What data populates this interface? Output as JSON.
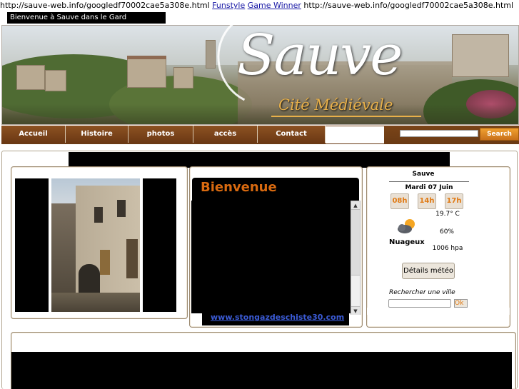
{
  "top": {
    "url_prefix": "http://sauve-web.info/googledf70002cae5a308e.html",
    "link1": "Funstyle",
    "link2": "Game Winner",
    "url_suffix": "http://sauve-web.info/googledf70002cae5a308e.html",
    "welcome": "Bienvenue à Sauve dans le Gard"
  },
  "banner": {
    "title": "Sauve",
    "subtitle": "Cité Médiévale"
  },
  "nav": {
    "items": [
      "Accueil",
      "Histoire",
      "photos",
      "accès",
      "Contact"
    ],
    "search_button": "Search"
  },
  "content": {
    "heading": "Bienvenue",
    "link": "www.stongazdeschiste30.com",
    "scroll_up": "▲",
    "scroll_down": "▼"
  },
  "weather": {
    "city": "Sauve",
    "date": "Mardi 07 Juin",
    "hours": [
      "08h",
      "14h",
      "17h"
    ],
    "temperature": "19.7° C",
    "icon": "cloudy-sun-icon",
    "humidity": "60%",
    "condition": "Nuageux",
    "pressure": "1006 hpa",
    "details_button": "Détails météo",
    "search_label": "Rechercher une ville",
    "ok_button": "Ok"
  },
  "colors": {
    "nav_brown": "#7a4418",
    "accent_orange": "#d96a10",
    "link_blue": "#3b5bd6"
  }
}
